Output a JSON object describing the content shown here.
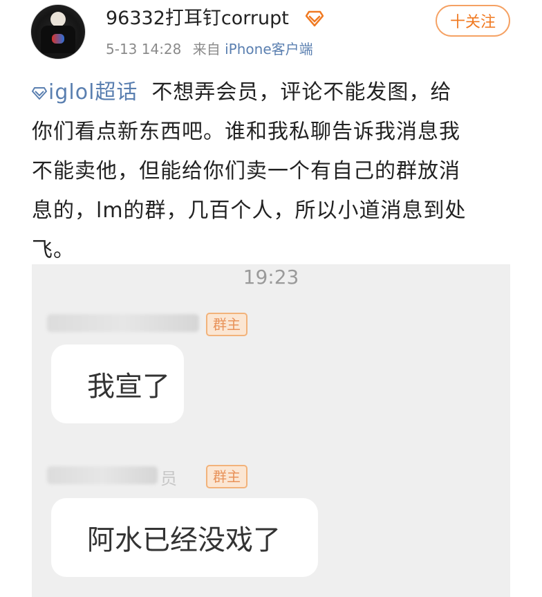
{
  "post": {
    "username": "96332打耳钉corrupt",
    "timestamp": "5-13 14:28",
    "source_prefix": "来自",
    "source": "iPhone客户端",
    "follow_label": "十关注",
    "topic": "iglol超话",
    "lines": [
      "不想弄会员，评论不能发图，给",
      "你们看点新东西吧。谁和我私聊告诉我消息我",
      "不能卖他，但能给你们卖一个有自己的群放消",
      "息的，lm的群，几百个人，所以小道消息到处",
      "飞。"
    ]
  },
  "screenshot": {
    "time": "19:23",
    "messages": [
      {
        "badge": "群主",
        "text": "我宣了"
      },
      {
        "partial_name": "员",
        "badge": "群主",
        "text": "阿水已经没戏了"
      }
    ]
  },
  "colors": {
    "accent_orange": "#f07a22",
    "link_blue": "#5a7fb0",
    "badge_bg": "#fbe6d3"
  },
  "icons": [
    "avatar",
    "vip-diamond-icon",
    "topic-diamond-icon"
  ]
}
